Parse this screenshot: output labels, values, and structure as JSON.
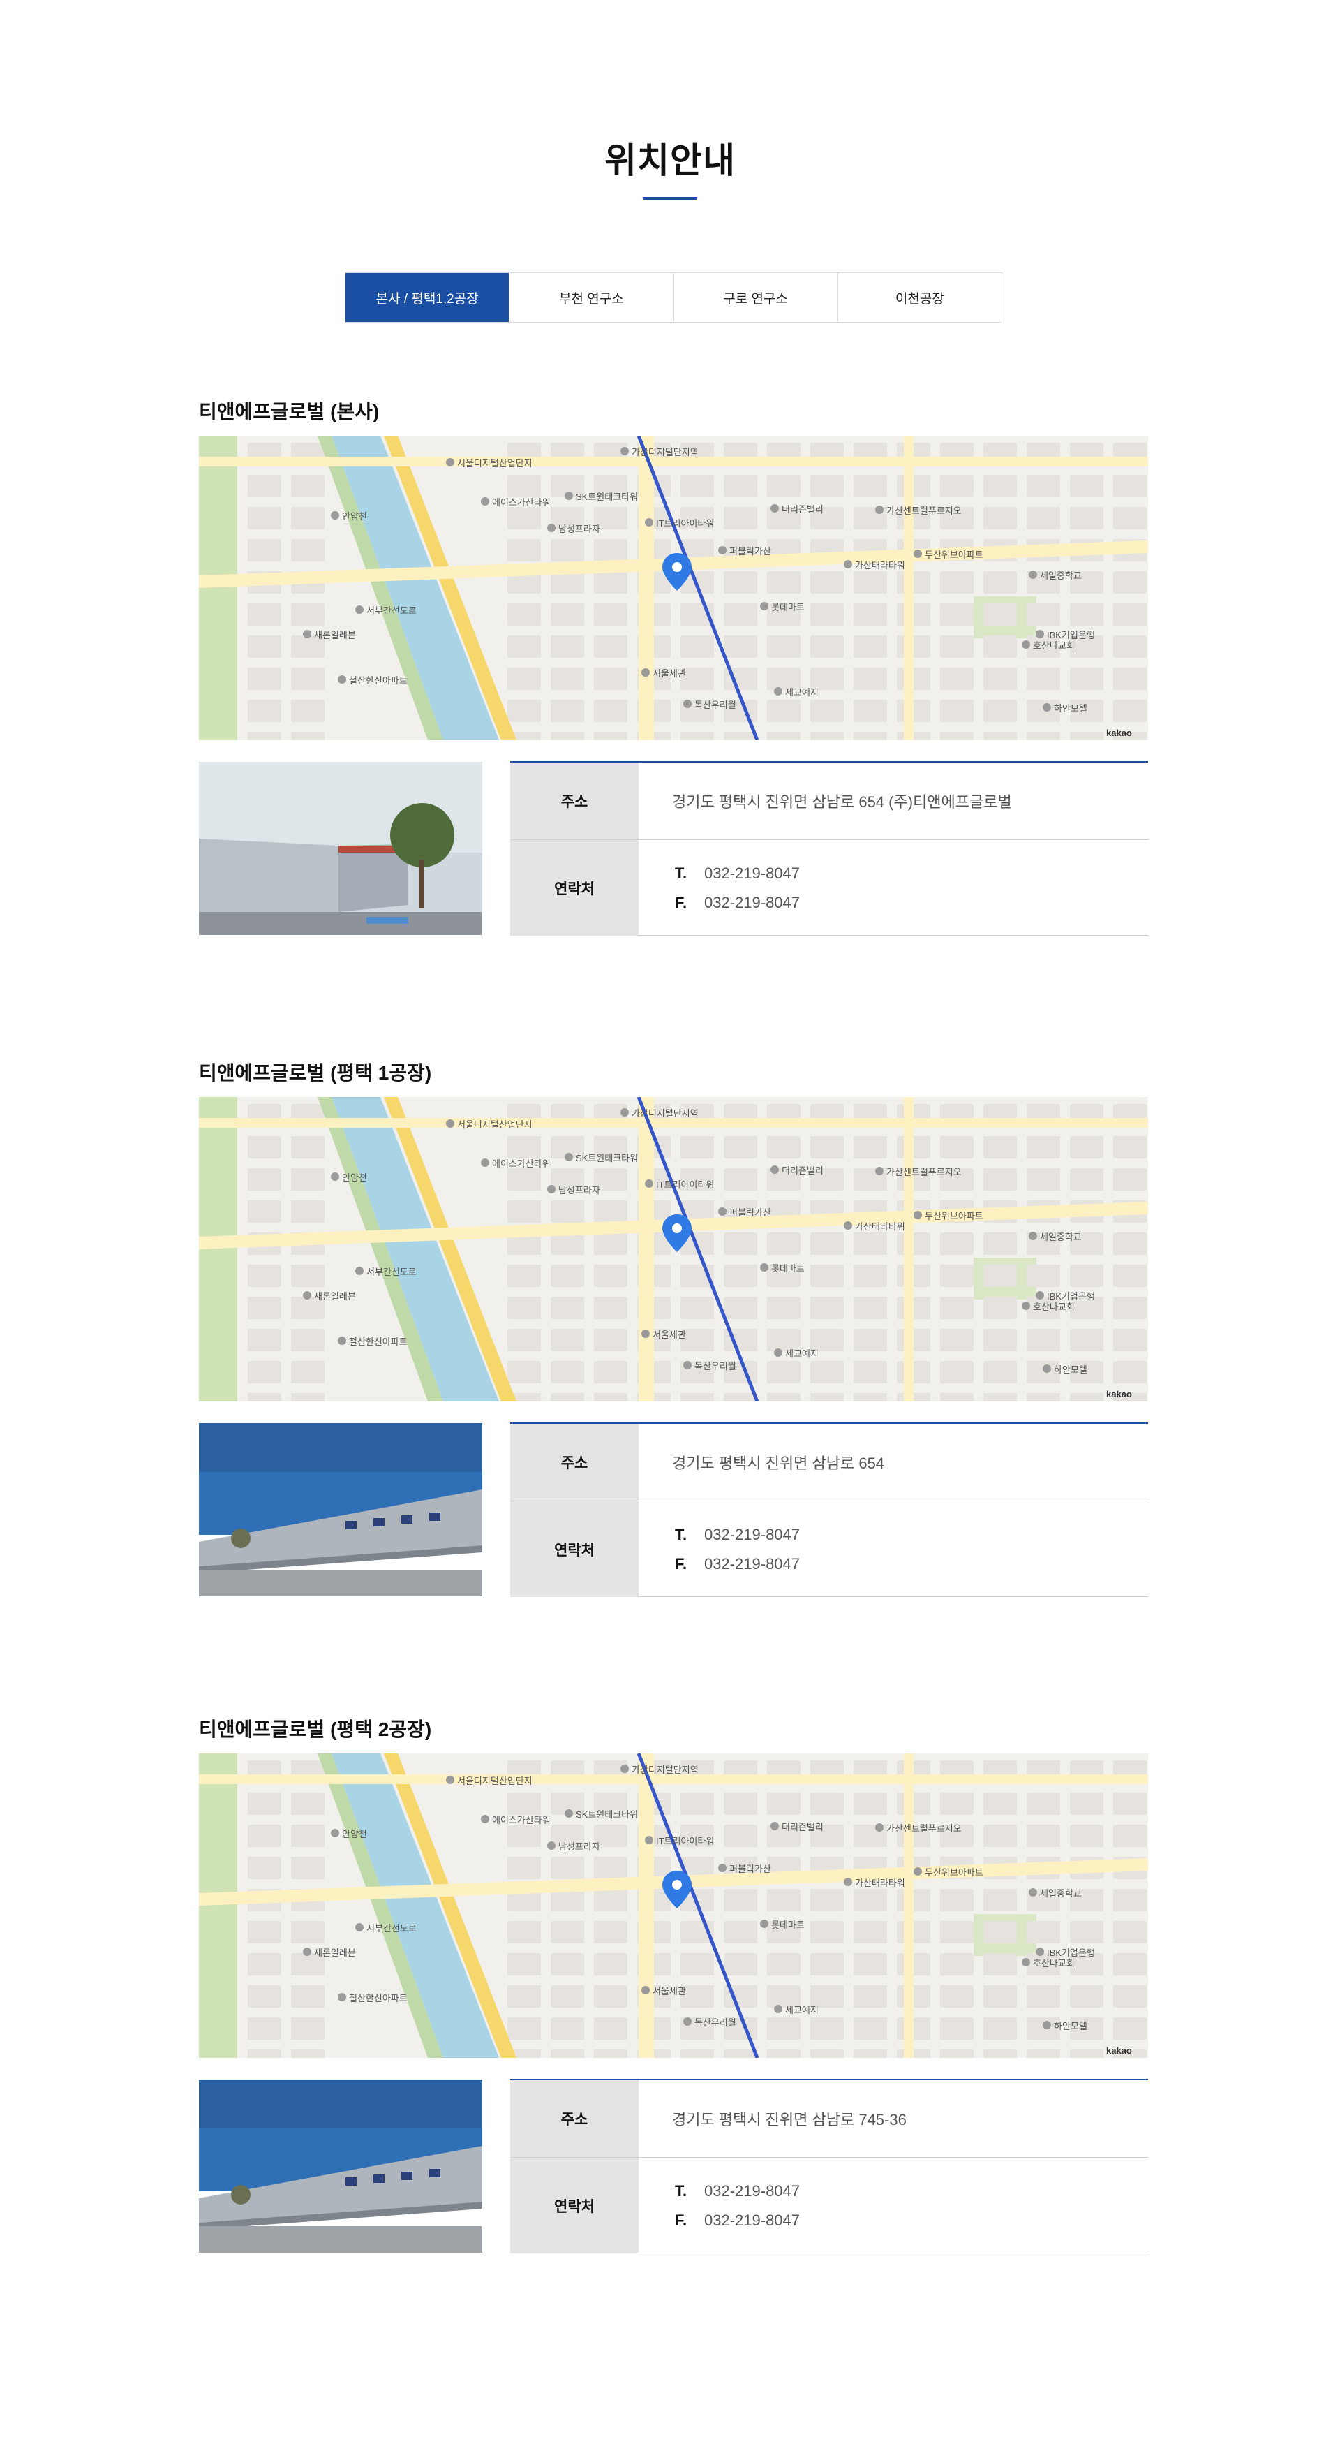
{
  "page": {
    "title": "위치안내"
  },
  "tabs": [
    {
      "label": "본사 / 평택1,2공장",
      "active": true
    },
    {
      "label": "부천 연구소",
      "active": false
    },
    {
      "label": "구로 연구소",
      "active": false
    },
    {
      "label": "이천공장",
      "active": false
    }
  ],
  "labels": {
    "address": "주소",
    "contact": "연락처",
    "tel": "T.",
    "fax": "F."
  },
  "map_labels": {
    "poi": [
      "가산디지털단지역",
      "서울디지털산업단지",
      "에이스가산타워",
      "SK트윈테크타워",
      "남성프라자",
      "IT트리아이타워",
      "퍼블릭가산",
      "더리즌밸리",
      "가산센트럴푸르지오",
      "가산태라타워",
      "롯데마트",
      "서울세관",
      "독산우리월",
      "세교예지",
      "세일중학교",
      "두산위브아파트",
      "IBK기업은행",
      "호산나교회",
      "하안모텔",
      "철산한신아파트",
      "새론일레븐",
      "안양천",
      "서부간선도로"
    ],
    "attribution": "kakao"
  },
  "locations": [
    {
      "title": "티앤에프글로벌 (본사)",
      "address": "경기도 평택시 진위면 삼남로 654 (주)티앤에프글로벌",
      "tel": "032-219-8047",
      "fax": "032-219-8047",
      "photo": "office-building-photo"
    },
    {
      "title": "티앤에프글로벌 (평택 1공장)",
      "address": "경기도 평택시 진위면 삼남로 654",
      "tel": "032-219-8047",
      "fax": "032-219-8047",
      "photo": "factory-building-photo"
    },
    {
      "title": "티앤에프글로벌 (평택 2공장)",
      "address": "경기도 평택시 진위면 삼남로 745-36",
      "tel": "032-219-8047",
      "fax": "032-219-8047",
      "photo": "factory-building-photo"
    }
  ],
  "colors": {
    "accent": "#1a4ea3",
    "tab_border": "#dcdcdc",
    "label_bg": "#e4e4e4",
    "river": "#a8d4e6",
    "park": "#cfe3b4",
    "road": "#f6d76b"
  }
}
